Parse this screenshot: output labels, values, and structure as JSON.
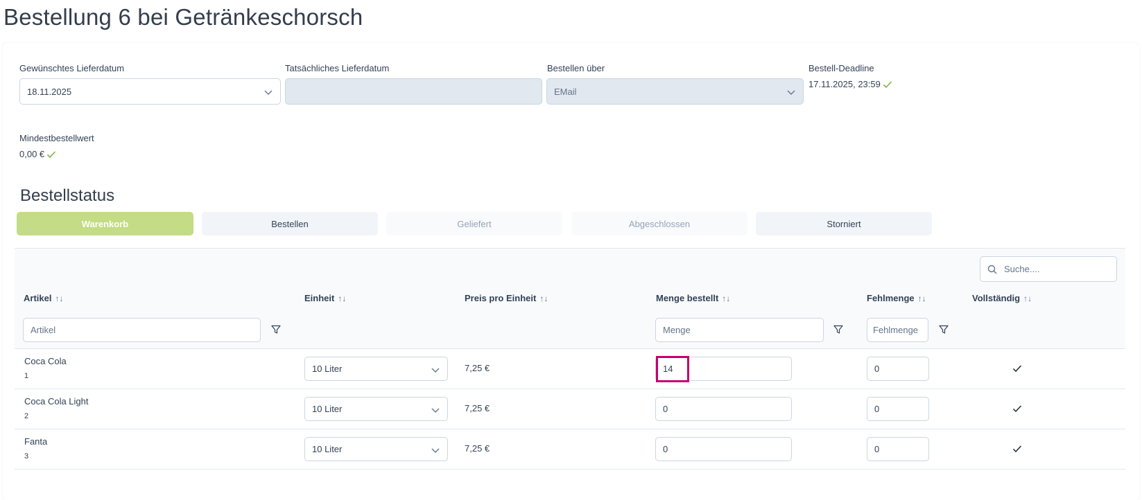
{
  "page": {
    "title": "Bestellung 6 bei Getränkeschorsch"
  },
  "fields": {
    "desired_date": {
      "label": "Gewünschtes Lieferdatum",
      "value": "18.11.2025"
    },
    "actual_date": {
      "label": "Tatsächliches Lieferdatum",
      "value": ""
    },
    "order_via": {
      "label": "Bestellen über",
      "value": "EMail"
    },
    "deadline": {
      "label": "Bestell-Deadline",
      "value": "17.11.2025, 23:59"
    },
    "min_value": {
      "label": "Mindestbestellwert",
      "value": "0,00 €"
    }
  },
  "status": {
    "title": "Bestellstatus",
    "steps": [
      "Warenkorb",
      "Bestellen",
      "Geliefert",
      "Abgeschlossen",
      "Storniert"
    ],
    "active": "Warenkorb"
  },
  "table": {
    "search_placeholder": "Suche....",
    "sort_glyph": "↑↓",
    "columns": [
      "Artikel",
      "Einheit",
      "Preis pro Einheit",
      "Menge bestellt",
      "Fehlmenge",
      "Vollständig"
    ],
    "filters": {
      "artikel_placeholder": "Artikel",
      "menge_placeholder": "Menge",
      "fehlmenge_placeholder": "Fehlmenge"
    },
    "rows": [
      {
        "name": "Coca Cola",
        "id": "1",
        "unit": "10 Liter",
        "price": "7,25 €",
        "qty": "14",
        "missing": "0",
        "complete": true
      },
      {
        "name": "Coca Cola Light",
        "id": "2",
        "unit": "10 Liter",
        "price": "7,25 €",
        "qty": "0",
        "missing": "0",
        "complete": true
      },
      {
        "name": "Fanta",
        "id": "3",
        "unit": "10 Liter",
        "price": "7,25 €",
        "qty": "0",
        "missing": "0",
        "complete": true
      }
    ]
  },
  "colors": {
    "accent_green": "#c3dc85",
    "check_green": "#7cb342",
    "highlight": "#c4006f"
  }
}
